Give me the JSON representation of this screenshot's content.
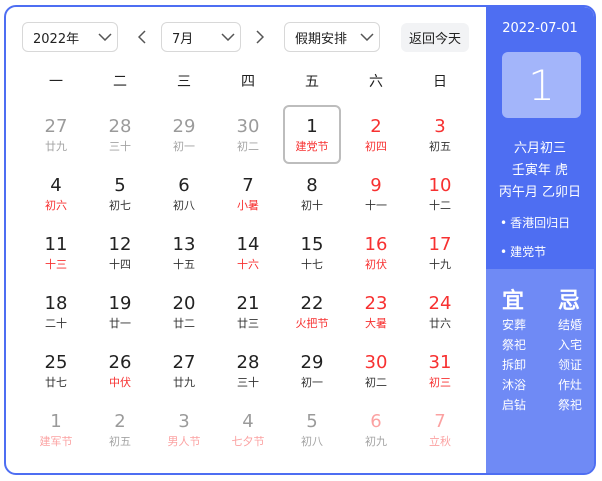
{
  "controls": {
    "year": "2022年",
    "month": "7月",
    "holiday": "假期安排",
    "today_button": "返回今天"
  },
  "weekdays": [
    "一",
    "二",
    "三",
    "四",
    "五",
    "六",
    "日"
  ],
  "weeks": [
    [
      {
        "d": "27",
        "l": "廿九",
        "dim": true
      },
      {
        "d": "28",
        "l": "三十",
        "dim": true
      },
      {
        "d": "29",
        "l": "初一",
        "dim": true
      },
      {
        "d": "30",
        "l": "初二",
        "dim": true
      },
      {
        "d": "1",
        "l": "建党节",
        "red": true,
        "today": true
      },
      {
        "d": "2",
        "l": "初四",
        "red": true,
        "we": true
      },
      {
        "d": "3",
        "l": "初五",
        "we": true
      }
    ],
    [
      {
        "d": "4",
        "l": "初六",
        "red": true
      },
      {
        "d": "5",
        "l": "初七"
      },
      {
        "d": "6",
        "l": "初八"
      },
      {
        "d": "7",
        "l": "小暑",
        "red": true
      },
      {
        "d": "8",
        "l": "初十"
      },
      {
        "d": "9",
        "l": "十一",
        "we": true
      },
      {
        "d": "10",
        "l": "十二",
        "we": true
      }
    ],
    [
      {
        "d": "11",
        "l": "十三",
        "red": true
      },
      {
        "d": "12",
        "l": "十四"
      },
      {
        "d": "13",
        "l": "十五"
      },
      {
        "d": "14",
        "l": "十六",
        "red": true
      },
      {
        "d": "15",
        "l": "十七"
      },
      {
        "d": "16",
        "l": "初伏",
        "red": true,
        "we": true
      },
      {
        "d": "17",
        "l": "十九",
        "we": true
      }
    ],
    [
      {
        "d": "18",
        "l": "二十"
      },
      {
        "d": "19",
        "l": "廿一"
      },
      {
        "d": "20",
        "l": "廿二"
      },
      {
        "d": "21",
        "l": "廿三"
      },
      {
        "d": "22",
        "l": "火把节",
        "red": true
      },
      {
        "d": "23",
        "l": "大暑",
        "red": true,
        "we": true
      },
      {
        "d": "24",
        "l": "廿六",
        "we": true
      }
    ],
    [
      {
        "d": "25",
        "l": "廿七"
      },
      {
        "d": "26",
        "l": "中伏",
        "red": true
      },
      {
        "d": "27",
        "l": "廿九"
      },
      {
        "d": "28",
        "l": "三十"
      },
      {
        "d": "29",
        "l": "初一"
      },
      {
        "d": "30",
        "l": "初二",
        "we": true
      },
      {
        "d": "31",
        "l": "初三",
        "red": true,
        "we": true
      }
    ],
    [
      {
        "d": "1",
        "l": "建军节",
        "red": true,
        "dim": true
      },
      {
        "d": "2",
        "l": "初五",
        "dim": true
      },
      {
        "d": "3",
        "l": "男人节",
        "red": true,
        "dim": true
      },
      {
        "d": "4",
        "l": "七夕节",
        "red": true,
        "dim": true
      },
      {
        "d": "5",
        "l": "初八",
        "dim": true
      },
      {
        "d": "6",
        "l": "初九",
        "dim": true,
        "we": true
      },
      {
        "d": "7",
        "l": "立秋",
        "red": true,
        "dim": true,
        "we": true
      }
    ]
  ],
  "sidebar": {
    "date": "2022-07-01",
    "day": "1",
    "lunar": "六月初三",
    "ganzhi_year": "壬寅年 虎",
    "ganzhi_month_day": "丙午月 乙卯日",
    "festivals": [
      "香港回归日",
      "建党节"
    ],
    "yi_title": "宜",
    "ji_title": "忌",
    "yi": [
      "安葬",
      "祭祀",
      "拆卸",
      "沐浴",
      "启钻"
    ],
    "ji": [
      "结婚",
      "入宅",
      "领证",
      "作灶",
      "祭祀"
    ]
  },
  "colors": {
    "accent": "#4e6ef2",
    "accent_light": "#6f8af5",
    "holiday_red": "#f73131"
  }
}
